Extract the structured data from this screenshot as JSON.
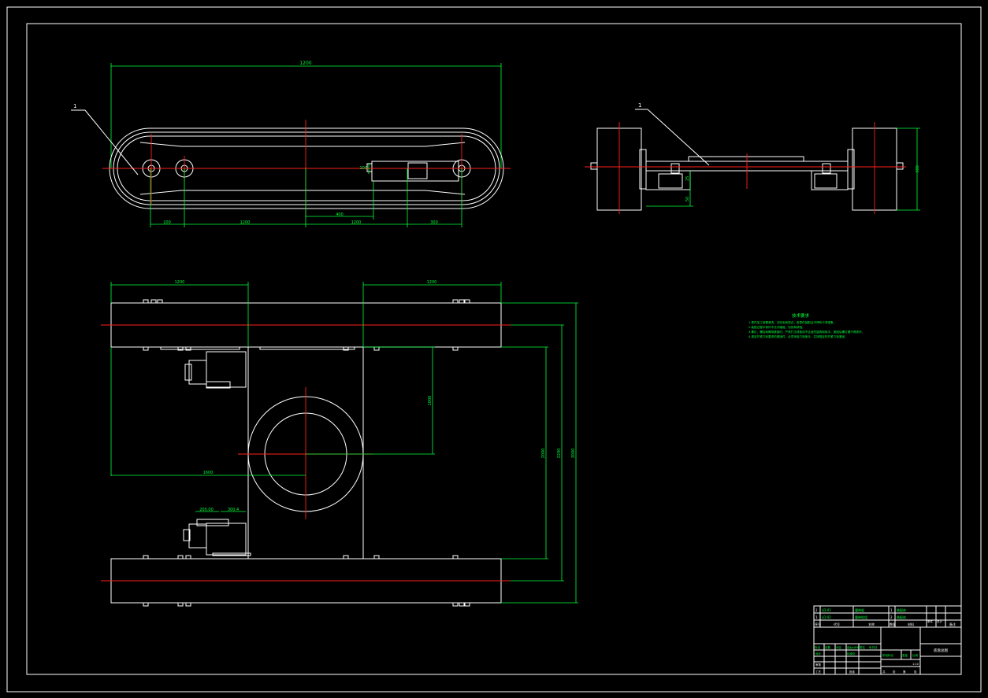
{
  "drawing": {
    "background": "#000000",
    "line_color": "#ffffff",
    "dimension_color": "#00ff3c",
    "centerline_color": "#ff2020"
  },
  "side_view": {
    "balloon": "1",
    "dim_overall": "1200",
    "dim_height": "100",
    "dims_bottom": [
      "100",
      "1200",
      "400",
      "1200",
      "300"
    ]
  },
  "end_view": {
    "balloon": "1",
    "dim_height": "300",
    "dims_small": [
      "25",
      "50"
    ]
  },
  "top_view": {
    "dim_left_top": "1200",
    "dim_right_top": "1200",
    "dim_left_bottom": "1600",
    "dim_center": "1000",
    "dims_right": [
      "2000",
      "2200",
      "3000"
    ],
    "motor_dims": [
      "200.00",
      "300.4"
    ]
  },
  "notes": {
    "title": "技术要求",
    "lines": [
      "1.零件加工前需清洗，去除毛刺锐边，各零件装配后不得有卡滞现象。",
      "2.装配过程中零件不允许磕碰、划伤和锈蚀。",
      "3.螺钉、螺栓和螺母紧固时，严禁打击或使用不合适的旋具和扳手，紧固后螺钉槽不得损坏。",
      "4.规定拧紧力矩要求的紧固件，必须采用力矩扳手，并按规定的拧紧力矩紧固。"
    ]
  },
  "title_block": {
    "rows": [
      [
        "2",
        "LD-01",
        "履带架",
        "1",
        "装配体"
      ],
      [
        "1",
        "LD-02",
        "履带轮组",
        "2",
        "装配体"
      ]
    ],
    "header": [
      "序号",
      "代号",
      "名称",
      "数量",
      "材料",
      "单件",
      "总计",
      "备注"
    ],
    "drawing_name": "底盘总图",
    "sign_labels": [
      "标记",
      "处数",
      "分区",
      "更改文件号",
      "签名",
      "年月日"
    ],
    "role_labels": [
      "设计",
      "标准化",
      "审核",
      "工艺",
      "批准"
    ],
    "stage_labels": [
      "阶段标记",
      "重量",
      "比例"
    ],
    "sheet_labels": [
      "共",
      "张",
      "第",
      "张"
    ],
    "scale": "1:10"
  }
}
